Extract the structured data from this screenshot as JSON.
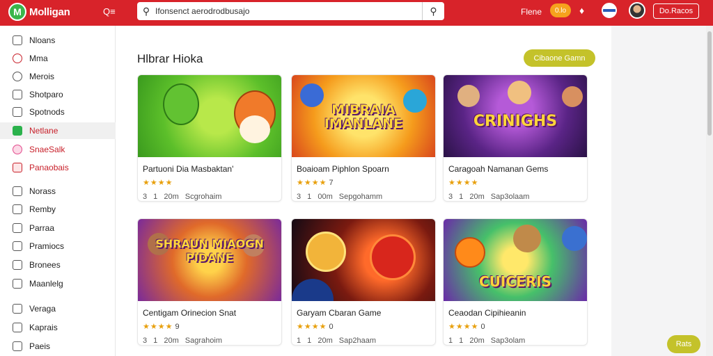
{
  "header": {
    "logo_text": "Molligan",
    "q_label": "Q≡",
    "search_value": "Ifonsenct aerodrodbusajo",
    "link": "Flene",
    "badge": "0.lo",
    "signin": "Do.Racos"
  },
  "sidebar": {
    "items": [
      {
        "label": "Nloans"
      },
      {
        "label": "Mma"
      },
      {
        "label": "Merois"
      },
      {
        "label": "Shotparo"
      },
      {
        "label": "Spotnods"
      },
      {
        "label": "Netlane"
      },
      {
        "label": "SnaeSalk"
      },
      {
        "label": "Panaobais"
      },
      {
        "label": "Norass"
      },
      {
        "label": "Remby"
      },
      {
        "label": "Parraa"
      },
      {
        "label": "Pramiocs"
      },
      {
        "label": "Bronees"
      },
      {
        "label": "Maanlelg"
      },
      {
        "label": "Veraga"
      },
      {
        "label": "Kaprais"
      },
      {
        "label": "Paeis"
      }
    ]
  },
  "main": {
    "title": "Hlbrar Hioka",
    "header_button": "Cibaone Gamn",
    "cards": [
      {
        "thumb_text": "",
        "title": "Partuoni Dia Masbaktan'",
        "stars": "★★★★",
        "rating": "",
        "meta": "3 1 20m Scgrohaim"
      },
      {
        "thumb_text": "MIBRAIA IMANLANE",
        "title": "Boaioam Piphlon Spoarn",
        "stars": "★★★★",
        "rating": "7",
        "meta": "3 1 00m Sepgohamm"
      },
      {
        "thumb_text": "CRINIGHS",
        "title": "Caragoah Namanan Gems",
        "stars": "★★★★",
        "rating": "",
        "meta": "3 1 20m Sap3olaam"
      },
      {
        "thumb_text": "SHRAUN MIAOGN PIDANE",
        "title": "Centigam Orinecion Snat",
        "stars": "★★★★",
        "rating": "9",
        "meta": "3 1 20m Sagrahoim"
      },
      {
        "thumb_text": "",
        "title": "Garyam Cbaran Game",
        "stars": "★★★★",
        "rating": "0",
        "meta": "1 1 20m Sap2haam"
      },
      {
        "thumb_text": "CUICERIS",
        "title": "Ceaodan Cipihieanin",
        "stars": "★★★★",
        "rating": "0",
        "meta": "1 1 20m Sap3olam"
      }
    ]
  },
  "chat_button": "Rats"
}
